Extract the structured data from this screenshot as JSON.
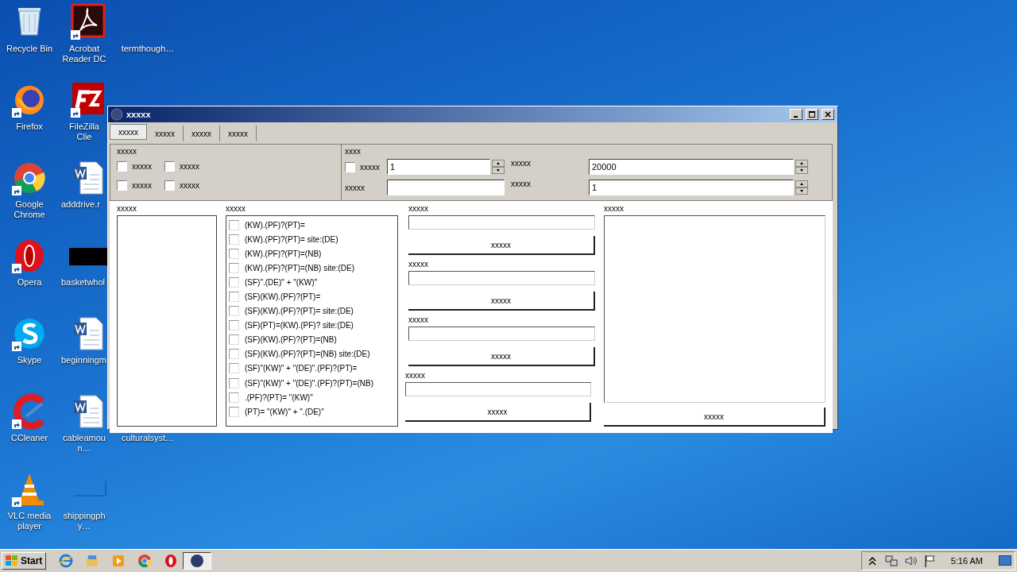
{
  "desktop": {
    "icons": [
      {
        "label": "Recycle Bin",
        "kind": "recycle",
        "shortcut": false
      },
      {
        "label": "Acrobat Reader DC",
        "kind": "acrobat",
        "shortcut": true
      },
      {
        "label": "termthough…",
        "kind": "blank",
        "shortcut": false
      },
      {
        "label": "Firefox",
        "kind": "firefox",
        "shortcut": true
      },
      {
        "label": "FileZilla Clie",
        "kind": "filezilla",
        "shortcut": true
      },
      {
        "label": "Google Chrome",
        "kind": "chrome",
        "shortcut": true
      },
      {
        "label": "adddrive.r",
        "kind": "word",
        "shortcut": false
      },
      {
        "label": "Opera",
        "kind": "opera",
        "shortcut": true
      },
      {
        "label": "basketwhol",
        "kind": "black",
        "shortcut": false
      },
      {
        "label": "Skype",
        "kind": "skype",
        "shortcut": true
      },
      {
        "label": "beginningm",
        "kind": "word",
        "shortcut": false
      },
      {
        "label": "CCleaner",
        "kind": "ccleaner",
        "shortcut": true
      },
      {
        "label": "cableamoun…",
        "kind": "word",
        "shortcut": false
      },
      {
        "label": "culturalsyst…",
        "kind": "blank",
        "shortcut": false
      },
      {
        "label": "VLC media player",
        "kind": "vlc",
        "shortcut": true
      },
      {
        "label": "shippingphy…",
        "kind": "blank",
        "shortcut": false
      }
    ]
  },
  "window": {
    "title": "xxxxx",
    "tabs": [
      {
        "label": "xxxxx",
        "selected": true
      },
      {
        "label": "xxxxx",
        "selected": false
      },
      {
        "label": "xxxxx",
        "selected": false
      },
      {
        "label": "xxxxx",
        "selected": false
      }
    ],
    "options_left": {
      "label": "xxxxx",
      "checkboxes": [
        {
          "label": "xxxxx",
          "checked": false
        },
        {
          "label": "xxxxx",
          "checked": false
        },
        {
          "label": "xxxxx",
          "checked": false
        },
        {
          "label": "xxxxx",
          "checked": false
        }
      ]
    },
    "options_right": {
      "label": "xxxx",
      "rows": [
        {
          "kind": "check",
          "label": "xxxxx",
          "checked": false,
          "value": "1",
          "label_2": "xxxxx",
          "value_2": "20000"
        },
        {
          "kind": "text",
          "label": "xxxxx",
          "label_2": "xxxxx",
          "value_2": "1"
        }
      ]
    },
    "list_panel": {
      "label": "xxxxx"
    },
    "pattern_panel": {
      "label": "xxxxx",
      "items": [
        {
          "label": "(KW).(PF)?(PT)=",
          "checked": false
        },
        {
          "label": "(KW).(PF)?(PT)= site:(DE)",
          "checked": false
        },
        {
          "label": "(KW).(PF)?(PT)=(NB)",
          "checked": false
        },
        {
          "label": "(KW).(PF)?(PT)=(NB) site:(DE)",
          "checked": false
        },
        {
          "label": "(SF)\".(DE)\" + \"(KW)\"",
          "checked": false
        },
        {
          "label": "(SF)(KW).(PF)?(PT)=",
          "checked": false
        },
        {
          "label": "(SF)(KW).(PF)?(PT)= site:(DE)",
          "checked": false
        },
        {
          "label": "(SF)(PT)=(KW).(PF)? site:(DE)",
          "checked": false
        },
        {
          "label": "(SF)(KW).(PF)?(PT)=(NB)",
          "checked": false
        },
        {
          "label": "(SF)(KW).(PF)?(PT)=(NB) site:(DE)",
          "checked": false
        },
        {
          "label": "(SF)\"(KW)\" + \"(DE)\".(PF)?(PT)=",
          "checked": false
        },
        {
          "label": "(SF)\"(KW)\" + \"(DE)\".(PF)?(PT)=(NB)",
          "checked": false
        },
        {
          "label": ".(PF)?(PT)= \"(KW)\"",
          "checked": false
        },
        {
          "label": "(PT)= \"(KW)\" + \".(DE)\"",
          "checked": false
        }
      ]
    },
    "action_groups": [
      {
        "label": "xxxxx",
        "button": "xxxxx"
      },
      {
        "label": "xxxxx",
        "button": "xxxxx"
      },
      {
        "label": "xxxxx",
        "button": "xxxxx"
      },
      {
        "label": "xxxxx",
        "button": "xxxxx"
      }
    ],
    "output_panel": {
      "label": "xxxxx",
      "button": "xxxxx"
    }
  },
  "taskbar": {
    "start": "Start",
    "pinned": [
      {
        "kind": "ie"
      },
      {
        "kind": "explorer"
      },
      {
        "kind": "media"
      },
      {
        "kind": "chrome"
      },
      {
        "kind": "opera"
      }
    ],
    "tasks": [
      {
        "kind": "app",
        "selected": true
      }
    ],
    "tray": [
      {
        "kind": "chevron"
      },
      {
        "kind": "network"
      },
      {
        "kind": "volume"
      },
      {
        "kind": "flag"
      }
    ],
    "clock": "5:16 AM"
  }
}
